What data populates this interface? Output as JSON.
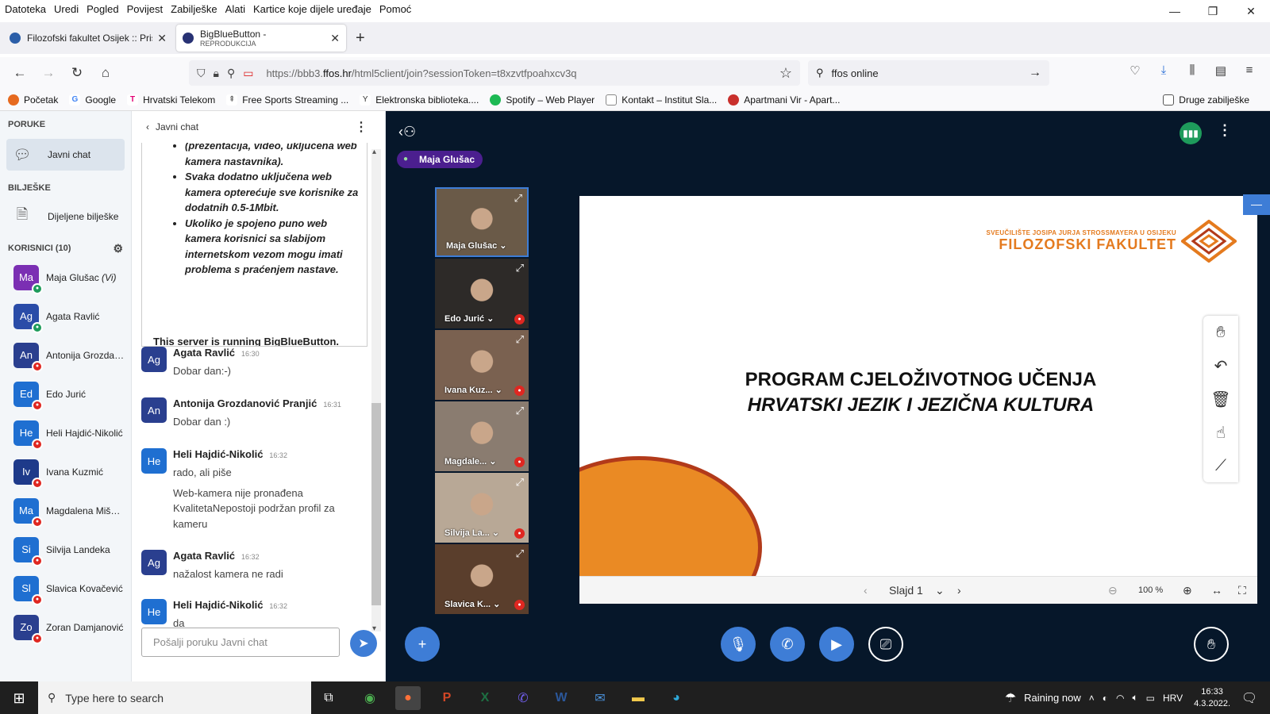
{
  "menu": [
    "Datoteka",
    "Uredi",
    "Pogled",
    "Povijest",
    "Zabilješke",
    "Alati",
    "Kartice koje dijele uređaje",
    "Pomoć"
  ],
  "tabs": [
    {
      "title": "Filozofski fakultet Osijek :: Pristup",
      "sub": "",
      "active": false
    },
    {
      "title": "BigBlueButton -",
      "sub": "REPRODUKCIJA",
      "active": true
    }
  ],
  "nav": {
    "url_prefix": "https://bbb3.",
    "url_domain": "ffos.hr",
    "url_rest": "/html5client/join?sessionToken=t8xzvtfpoahxcv3q",
    "search": "ffos online"
  },
  "bookmarks": [
    "Početak",
    "Google",
    "Hrvatski Telekom",
    "Free Sports Streaming ...",
    "Elektronska biblioteka....",
    "Spotify – Web Player",
    "Kontakt – Institut Sla...",
    "Apartmani Vir - Apart..."
  ],
  "bookmarks_other": "Druge zabilješke",
  "sidebar": {
    "messages_title": "PORUKE",
    "public_chat": "Javni chat",
    "notes_title": "BILJEŠKE",
    "shared_notes": "Dijeljene bilješke",
    "users_title": "KORISNICI (10)",
    "users": [
      {
        "initials": "Ma",
        "name": "Maja Glušac",
        "you": "(Vi)",
        "color": "#7b2fb3",
        "mic": "on"
      },
      {
        "initials": "Ag",
        "name": "Agata Ravlić",
        "you": "",
        "color": "#2a4ca8",
        "mic": "on"
      },
      {
        "initials": "An",
        "name": "Antonija Grozdanović Pranjić",
        "you": "",
        "color": "#2a3f8f",
        "mic": "off"
      },
      {
        "initials": "Ed",
        "name": "Edo Jurić",
        "you": "",
        "color": "#1f6fd1",
        "mic": "off"
      },
      {
        "initials": "He",
        "name": "Heli Hajdić-Nikolić",
        "you": "",
        "color": "#1f6fd1",
        "mic": "off"
      },
      {
        "initials": "Iv",
        "name": "Ivana Kuzmić",
        "you": "",
        "color": "#1e3a8a",
        "mic": "off"
      },
      {
        "initials": "Ma",
        "name": "Magdalena Mišetić",
        "you": "",
        "color": "#1f6fd1",
        "mic": "off"
      },
      {
        "initials": "Si",
        "name": "Silvija Landeka",
        "you": "",
        "color": "#1f6fd1",
        "mic": "off"
      },
      {
        "initials": "Sl",
        "name": "Slavica Kovačević",
        "you": "",
        "color": "#1f6fd1",
        "mic": "off"
      },
      {
        "initials": "Zo",
        "name": "Zoran Damjanović",
        "you": "",
        "color": "#2a3f8f",
        "mic": "off"
      }
    ]
  },
  "chat": {
    "back_label": "Javni chat",
    "welcome_items": [
      "(prezentacija, video, uključena web kamera nastavnika).",
      "Svaka dodatno uključena web kamera opterećuje sve korisnike za dodatnih 0.5-1Mbit.",
      "Ukoliko je spojeno puno web kamera korisnici sa slabijom internetskom vezom mogu imati problema s praćenjem nastave."
    ],
    "server_prefix": "This server is running ",
    "server_link": "BigBlueButton",
    "server_suffix": ".",
    "messages": [
      {
        "initials": "Ag",
        "color": "#2a3f8f",
        "name": "Agata Ravlić",
        "time": "16:30",
        "text": "Dobar dan:-)",
        "extra": ""
      },
      {
        "initials": "An",
        "color": "#2a3f8f",
        "name": "Antonija Grozdanović Pranjić",
        "time": "16:31",
        "text": "Dobar dan :)",
        "extra": ""
      },
      {
        "initials": "He",
        "color": "#1f6fd1",
        "name": "Heli Hajdić-Nikolić",
        "time": "16:32",
        "text": "rado, ali piše",
        "extra": "Web-kamera nije pronađena KvalitetaNepostoji podržan profil za kameru"
      },
      {
        "initials": "Ag",
        "color": "#2a3f8f",
        "name": "Agata Ravlić",
        "time": "16:32",
        "text": "nažalost kamera ne radi",
        "extra": ""
      },
      {
        "initials": "He",
        "color": "#1f6fd1",
        "name": "Heli Hajdić-Nikolić",
        "time": "16:32",
        "text": "da",
        "extra": ""
      }
    ],
    "input_placeholder": "Pošalji poruku Javni chat"
  },
  "main": {
    "talker": "Maja Glušac",
    "videos": [
      {
        "name": "Maja Glušac",
        "bg": "#6a5a48",
        "active": true,
        "muted": false
      },
      {
        "name": "Edo Jurić",
        "bg": "#2d2a28",
        "active": false,
        "muted": true
      },
      {
        "name": "Ivana Kuz...",
        "bg": "#7a6150",
        "active": false,
        "muted": true
      },
      {
        "name": "Magdale...",
        "bg": "#8a7c70",
        "active": false,
        "muted": true
      },
      {
        "name": "Silvija La...",
        "bg": "#b8a896",
        "active": false,
        "muted": true
      },
      {
        "name": "Slavica K...",
        "bg": "#5a3e2c",
        "active": false,
        "muted": true
      }
    ],
    "slide": {
      "logo_line1": "SVEUČILIŠTE JOSIPA JURJA STROSSMAYERA U OSIJEKU",
      "logo_line2": "FILOZOFSKI  FAKULTET",
      "title1": "PROGRAM CJELOŽIVOTNOG UČENJA",
      "title2": "HRVATSKI JEZIK I JEZIČNA KULTURA"
    },
    "slide_label": "Slajd 1",
    "zoom": "100 %"
  },
  "taskbar": {
    "search": "Type here to search",
    "weather": "Raining now",
    "lang": "HRV",
    "time": "16:33",
    "date": "4.3.2022."
  },
  "colors": {
    "accent": "#3e7dd6",
    "main_bg": "#06172a",
    "slide_orange": "#ea8a24",
    "logo_orange": "#e47a1e",
    "mute_red": "#df2721",
    "talk_green": "#1e9b5b"
  }
}
